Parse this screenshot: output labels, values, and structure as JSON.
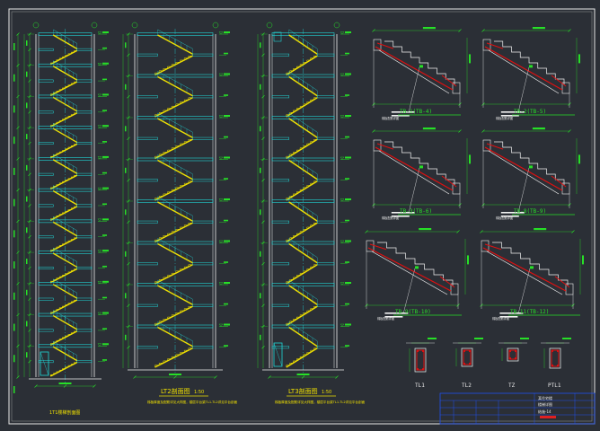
{
  "colors": {
    "background": "#2b2f36",
    "frame": "#e8e8e8",
    "stair_yellow": "#f0e000",
    "slab_cyan": "#20d8d8",
    "dim_green": "#27e027",
    "wall_white": "#f2f2f2",
    "rebar_red": "#e01010",
    "title_yellow": "#f0e000",
    "title_block_blue": "#2050f0",
    "stamp_red": "#e02020"
  },
  "elevations": {
    "left_caption": "1T1楼梯剖面图"
  },
  "middle": {
    "title": "LT2剖面图",
    "scale": "1:50",
    "note": "梯板厚度及配筋详见大样图，楼层平台梁TL1-TL2详见平台剖面"
  },
  "right_elevation": {
    "title": "LT3剖面图",
    "scale": "1:50",
    "note": "梯板厚度及配筋详见大样图，楼层平台梁TL1-TL2详见平台剖面"
  },
  "details": [
    {
      "label": "TB-1(TB-4)",
      "sub": "梯板配筋详图"
    },
    {
      "label": "TB-2(TB-5)",
      "sub": "梯板配筋详图"
    },
    {
      "label": "TB-3(TB-6)",
      "sub": "梯板配筋详图"
    },
    {
      "label": "TB-8(TB-9)",
      "sub": "梯板配筋详图"
    },
    {
      "label": "TB-9(TB-10)",
      "sub": "梯板配筋详图"
    },
    {
      "label": "TB-11(TB-12)",
      "sub": "梯板配筋详图"
    }
  ],
  "beams": [
    "TL1",
    "TL2",
    "TZ",
    "PTL1"
  ],
  "title_block": {
    "project": "某住宅楼",
    "drawing": "楼梯详图",
    "drawing_no": "结施-14"
  }
}
